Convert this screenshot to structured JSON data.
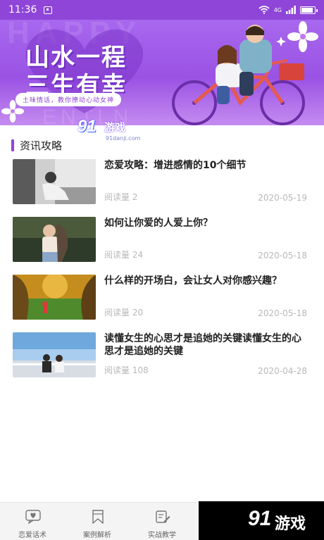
{
  "status_bar": {
    "time": "11:36",
    "network": "4G"
  },
  "banner": {
    "title_line1": "山水一程",
    "title_line2": "三生有幸",
    "slogan": "土味情话，教你撩动心动女神",
    "bg_word": "HAPPY",
    "bg_word2": "ENTLN"
  },
  "section": {
    "title": "资讯攻略"
  },
  "articles": [
    {
      "title": "恋爱攻略：增进感情的10个细节",
      "reads": "阅读量 2",
      "date": "2020-05-19"
    },
    {
      "title": "如何让你爱的人爱上你？",
      "reads": "阅读量 24",
      "date": "2020-05-18"
    },
    {
      "title": "什么样的开场白，会让女人对你感兴趣？",
      "reads": "阅读量 20",
      "date": "2020-05-18"
    },
    {
      "title": "读懂女生的心思才是追她的关键读懂女生的心思才是追她的关键",
      "reads": "阅读量 108",
      "date": "2020-04-28"
    }
  ],
  "nav": [
    {
      "label": "恋爱话术",
      "icon": "chat-heart-icon"
    },
    {
      "label": "案例解析",
      "icon": "bookmark-icon"
    },
    {
      "label": "实战教学",
      "icon": "edit-book-icon"
    },
    {
      "label": "",
      "icon": "profile-icon"
    }
  ],
  "watermark": {
    "logo": "91",
    "text": "游戏",
    "url": "91danji.com"
  },
  "colors": {
    "primary": "#8e45d8",
    "text": "#222222",
    "muted": "#b8b8b8"
  }
}
